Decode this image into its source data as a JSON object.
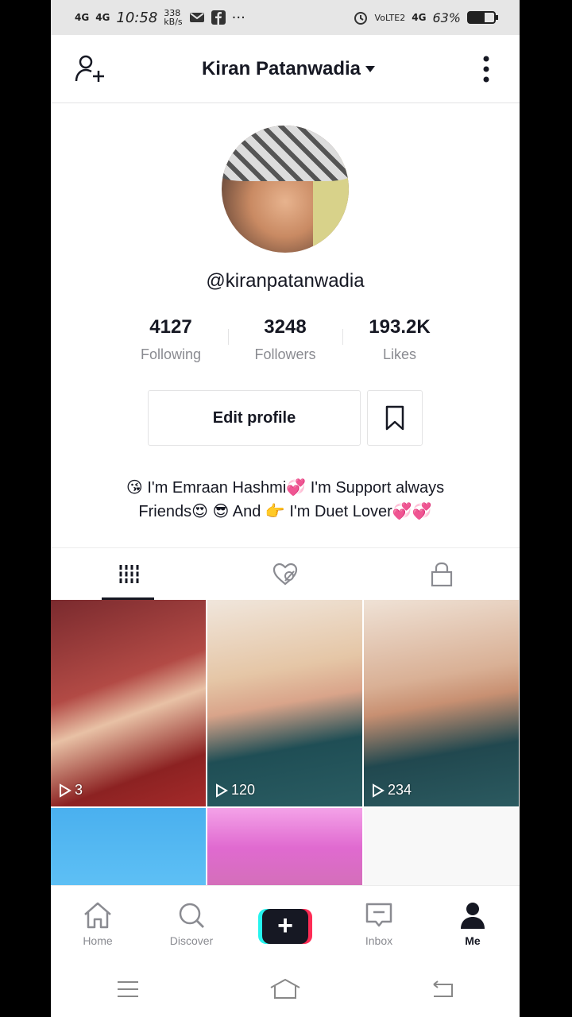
{
  "status_bar": {
    "signal_1": "4G",
    "signal_2": "4G",
    "time": "10:58",
    "speed": "338",
    "speed_unit": "kB/s",
    "network": "VoLTE2",
    "signal_3": "4G",
    "battery": "63%",
    "battery_level": 0.63
  },
  "header": {
    "title": "Kiran Patanwadia"
  },
  "profile": {
    "handle": "@kiranpatanwadia",
    "stats": [
      {
        "value": "4127",
        "label": "Following"
      },
      {
        "value": "3248",
        "label": "Followers"
      },
      {
        "value": "193.2K",
        "label": "Likes"
      }
    ],
    "edit_label": "Edit profile",
    "bio_line1": "😘 I'm Emraan Hashmi💞 I'm Support always",
    "bio_line2": "Friends😍 😎 And 👉 I'm Duet Lover💞💞"
  },
  "videos": [
    {
      "count": "3"
    },
    {
      "count": "120"
    },
    {
      "count": "234"
    }
  ],
  "bottom_nav": {
    "home": "Home",
    "discover": "Discover",
    "plus": "+",
    "inbox": "Inbox",
    "me": "Me"
  }
}
